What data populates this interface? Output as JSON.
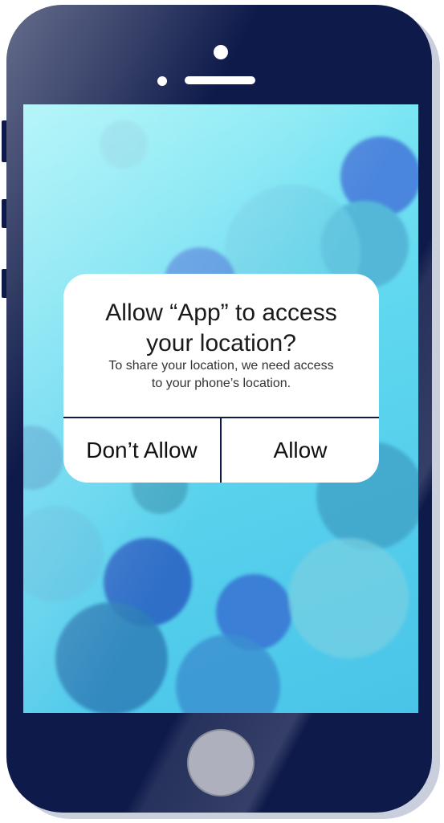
{
  "dialog": {
    "title_line1": "Allow “App” to access",
    "title_line2": "your location?",
    "message_line1": "To share your location, we need access",
    "message_line2": "to your phone’s location.",
    "deny_label": "Don’t Allow",
    "allow_label": "Allow"
  },
  "colors": {
    "phone_body": "#0e1a4a",
    "screen_wallpaper": "#5fd7ef",
    "dialog_background": "#ffffff",
    "home_button": "#aeb1bd"
  }
}
